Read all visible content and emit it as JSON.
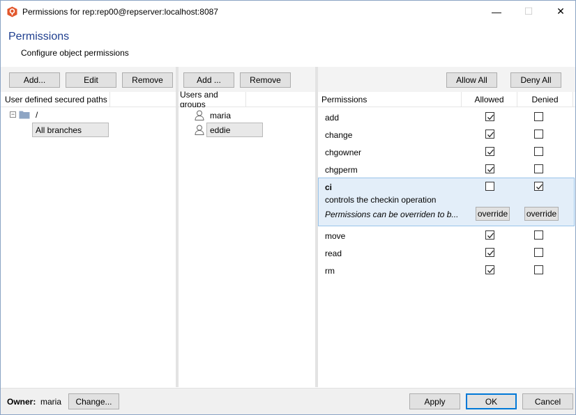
{
  "window": {
    "title": "Permissions for rep:rep00@repserver:localhost:8087",
    "min_glyph": "—",
    "max_glyph": "☐",
    "close_glyph": "✕"
  },
  "header": {
    "title": "Permissions",
    "subtitle": "Configure object permissions"
  },
  "paths_panel": {
    "add_label": "Add...",
    "edit_label": "Edit",
    "remove_label": "Remove",
    "column_header": "User defined secured paths",
    "root_path": "/",
    "selected_branch": "All branches"
  },
  "users_panel": {
    "add_label": "Add ...",
    "remove_label": "Remove",
    "column_header": "Users and groups",
    "users": [
      "maria",
      "eddie"
    ],
    "selected_user": "eddie"
  },
  "permissions_panel": {
    "allow_all_label": "Allow All",
    "deny_all_label": "Deny All",
    "col_permissions": "Permissions",
    "col_allowed": "Allowed",
    "col_denied": "Denied",
    "rows": [
      {
        "name": "add",
        "allowed": true,
        "denied": false
      },
      {
        "name": "change",
        "allowed": true,
        "denied": false
      },
      {
        "name": "chgowner",
        "allowed": true,
        "denied": false
      },
      {
        "name": "chgperm",
        "allowed": true,
        "denied": false
      },
      {
        "name": "ci",
        "allowed": false,
        "denied": true
      },
      {
        "name": "move",
        "allowed": true,
        "denied": false
      },
      {
        "name": "read",
        "allowed": true,
        "denied": false
      },
      {
        "name": "rm",
        "allowed": true,
        "denied": false
      }
    ],
    "selected": {
      "name": "ci",
      "description": "controls the checkin operation",
      "note": "Permissions can be overriden to b...",
      "override_allowed_label": "override",
      "override_denied_label": "override"
    }
  },
  "footer": {
    "owner_label": "Owner:",
    "owner_value": "maria",
    "change_label": "Change...",
    "apply_label": "Apply",
    "ok_label": "OK",
    "cancel_label": "Cancel"
  },
  "colors": {
    "accent": "#1f3f8f",
    "selection_bg": "#e3eef9",
    "selection_border": "#99c4ea",
    "default_button_border": "#0078d7",
    "app_icon": "#e2562b"
  }
}
